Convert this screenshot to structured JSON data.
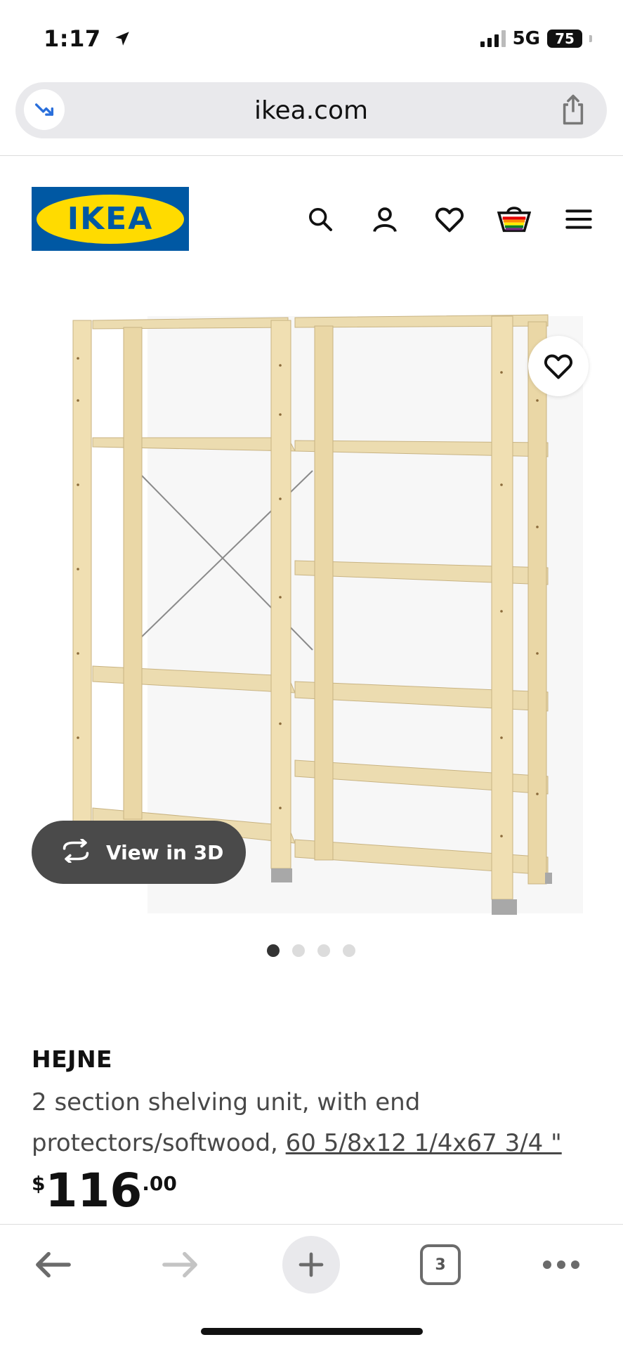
{
  "status_bar": {
    "time": "1:17",
    "network": "5G",
    "battery": "75"
  },
  "browser": {
    "url": "ikea.com",
    "open_tabs": "3"
  },
  "header": {
    "logo_text": "IKEA",
    "icons": [
      "search-icon",
      "account-icon",
      "favorites-icon",
      "cart-icon",
      "menu-icon"
    ]
  },
  "gallery": {
    "view_3d_label": "View in 3D",
    "image_count": 4,
    "active_image": 1
  },
  "product": {
    "name": "HEJNE",
    "description": "2 section shelving unit, with end protectors/softwood, ",
    "dimensions": "60 5/8x12 1/4x67 3/4 \"",
    "price_currency": "$",
    "price_integer": "116",
    "price_decimal": ".00"
  },
  "colors": {
    "ikea_blue": "#0058a3",
    "ikea_yellow": "#ffdb00"
  }
}
